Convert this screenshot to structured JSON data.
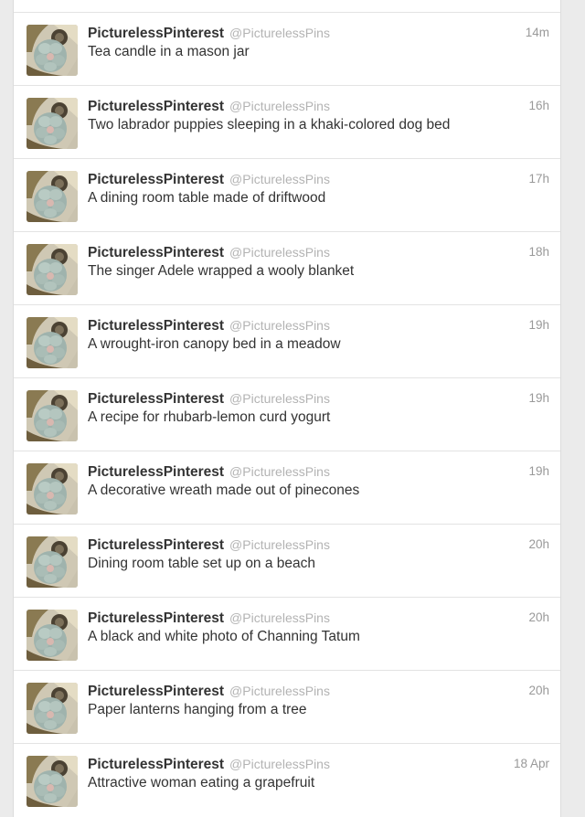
{
  "timeline": {
    "tweets": [
      {
        "fullname": "PicturelessPinterest",
        "username": "@PicturelessPins",
        "time": "14m",
        "text": "Tea candle in a mason jar"
      },
      {
        "fullname": "PicturelessPinterest",
        "username": "@PicturelessPins",
        "time": "16h",
        "text": "Two labrador puppies sleeping in a khaki-colored dog bed"
      },
      {
        "fullname": "PicturelessPinterest",
        "username": "@PicturelessPins",
        "time": "17h",
        "text": "A dining room table made of driftwood"
      },
      {
        "fullname": "PicturelessPinterest",
        "username": "@PicturelessPins",
        "time": "18h",
        "text": "The singer Adele wrapped a wooly blanket"
      },
      {
        "fullname": "PicturelessPinterest",
        "username": "@PicturelessPins",
        "time": "19h",
        "text": "A wrought-iron canopy bed in a meadow"
      },
      {
        "fullname": "PicturelessPinterest",
        "username": "@PicturelessPins",
        "time": "19h",
        "text": "A recipe for rhubarb-lemon curd yogurt"
      },
      {
        "fullname": "PicturelessPinterest",
        "username": "@PicturelessPins",
        "time": "19h",
        "text": "A decorative wreath made out of pinecones"
      },
      {
        "fullname": "PicturelessPinterest",
        "username": "@PicturelessPins",
        "time": "20h",
        "text": "Dining room table set up on a beach"
      },
      {
        "fullname": "PicturelessPinterest",
        "username": "@PicturelessPins",
        "time": "20h",
        "text": "A black and white photo of Channing Tatum"
      },
      {
        "fullname": "PicturelessPinterest",
        "username": "@PicturelessPins",
        "time": "20h",
        "text": "Paper lanterns hanging from a tree"
      },
      {
        "fullname": "PicturelessPinterest",
        "username": "@PicturelessPins",
        "time": "18 Apr",
        "text": "Attractive woman eating a grapefruit"
      }
    ]
  },
  "colors": {
    "name": "#333333",
    "username": "#b3b3b3",
    "time": "#999999",
    "divider": "#e3e3e3",
    "page_background": "#ebebeb"
  },
  "icons": {
    "avatar": "profile-photo"
  }
}
